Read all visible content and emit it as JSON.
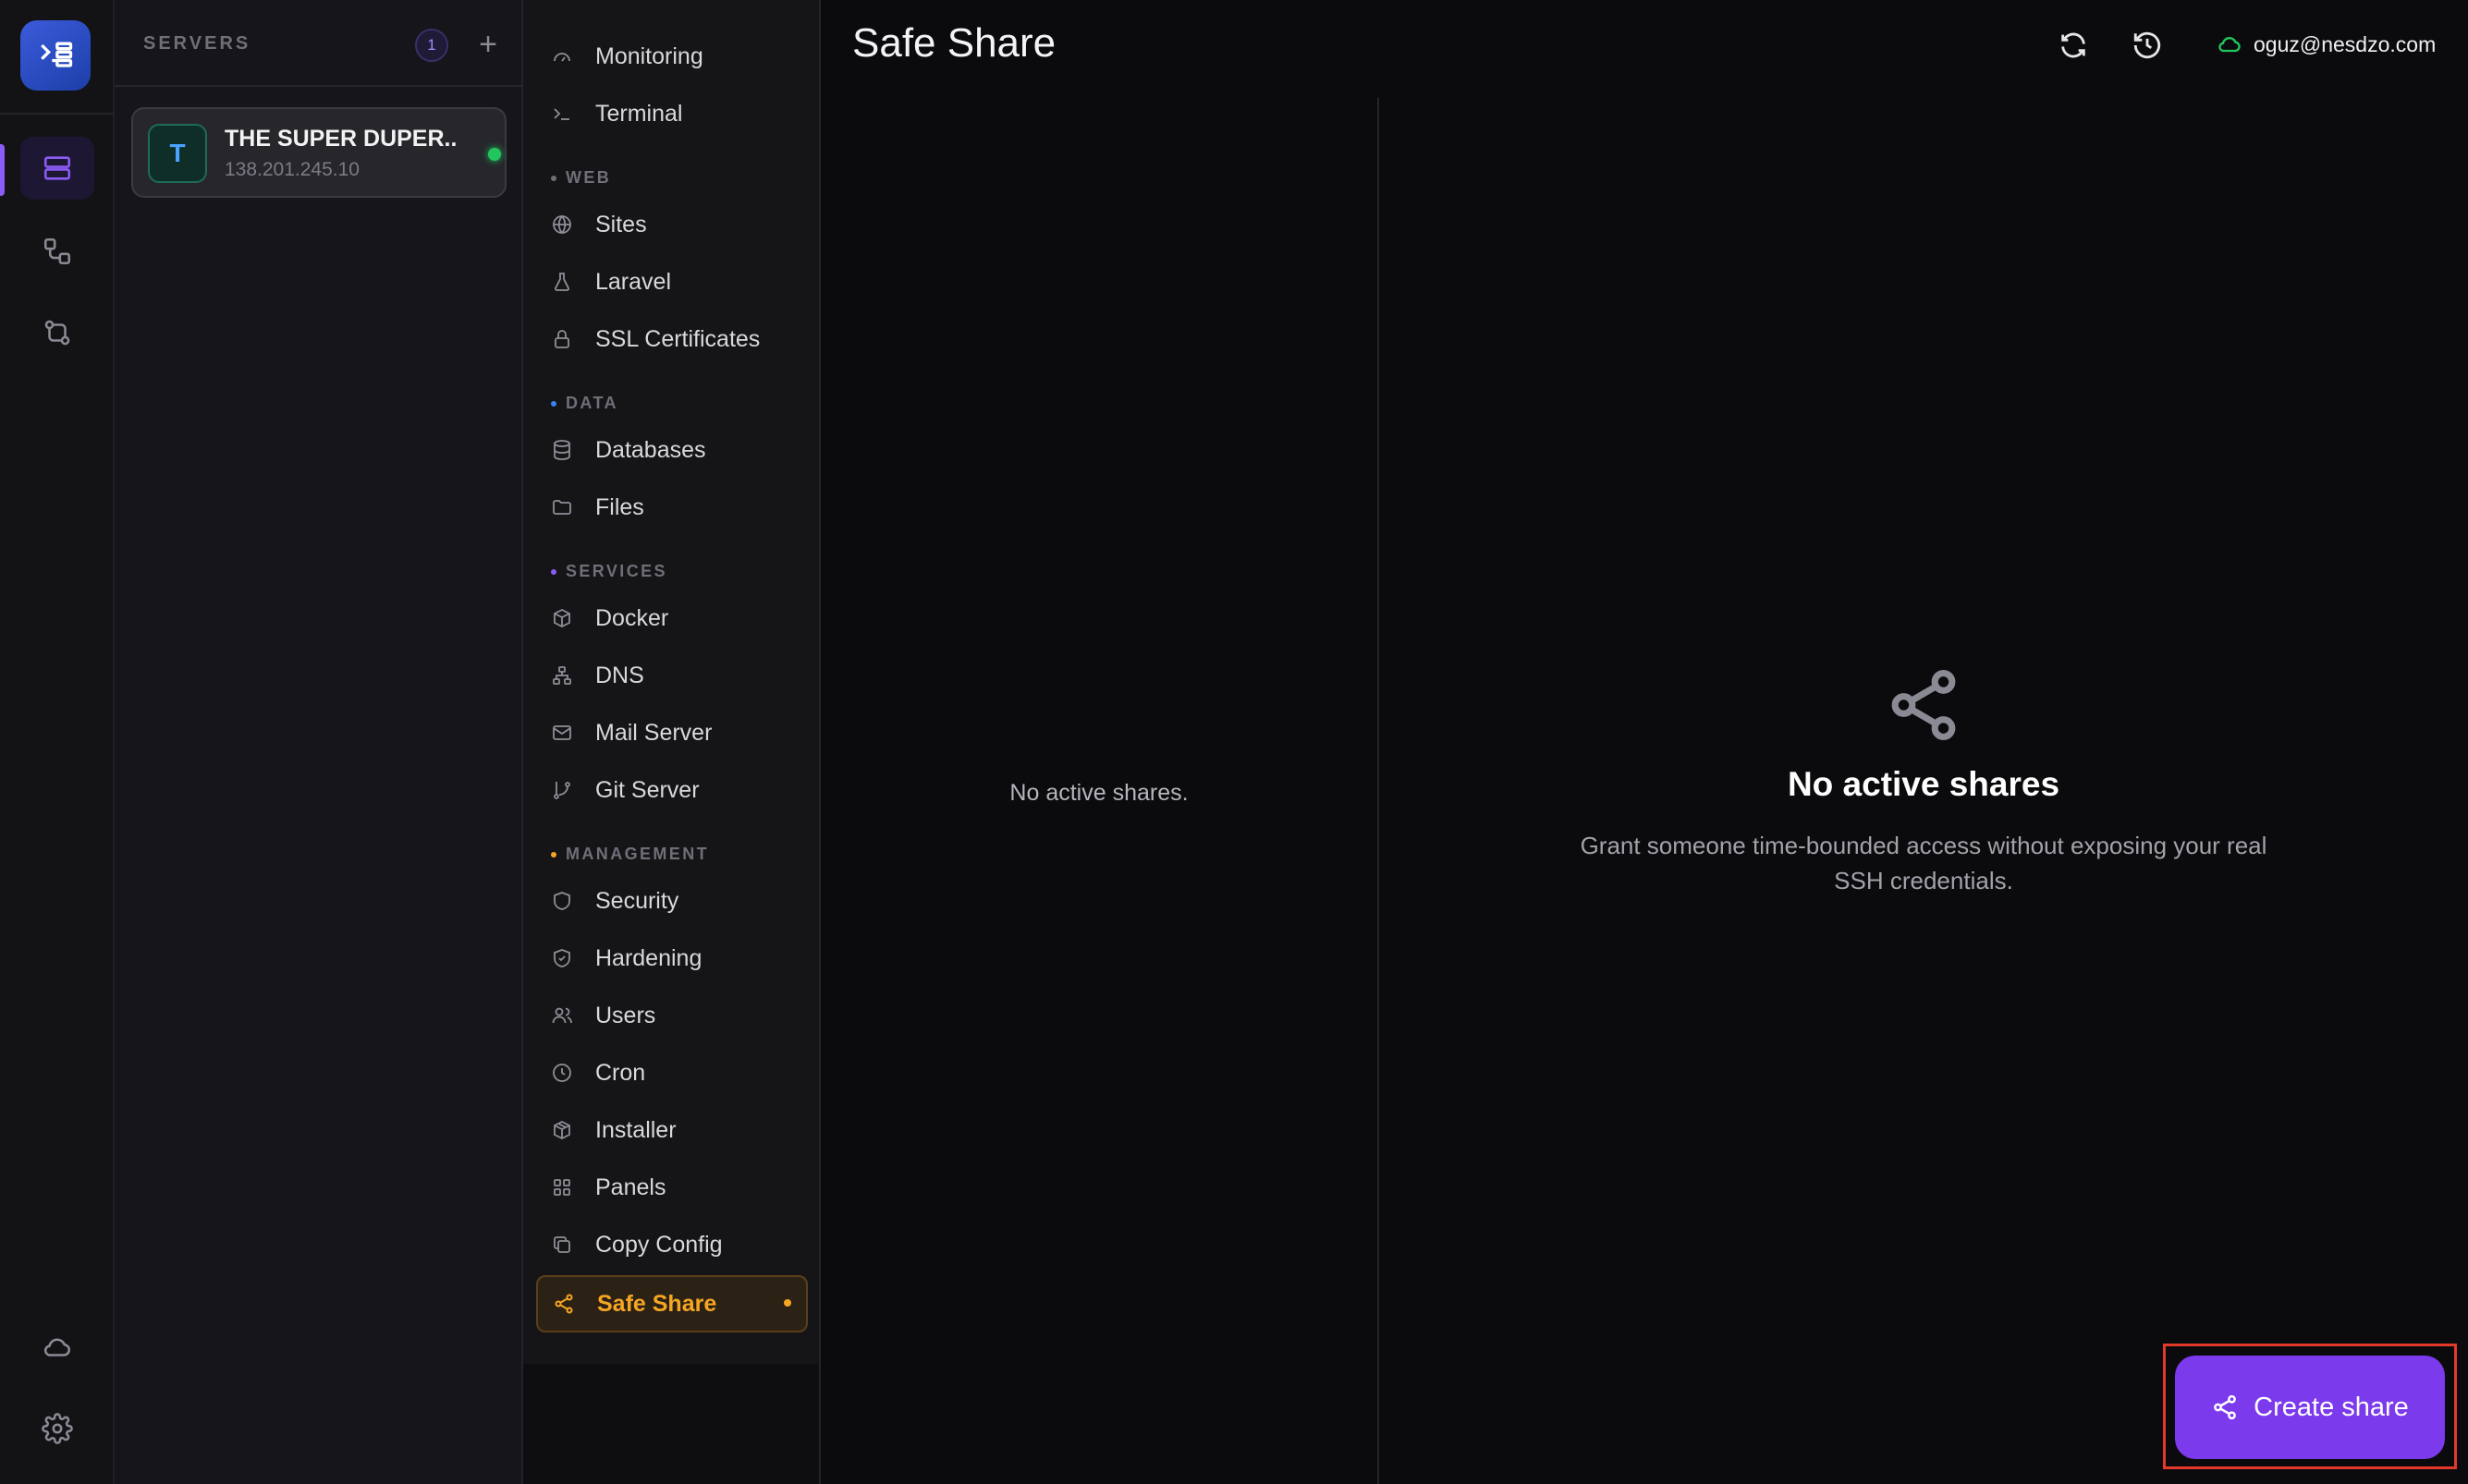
{
  "servers": {
    "heading": "SERVERS",
    "count": "1",
    "add": "+",
    "items": [
      {
        "initial": "T",
        "name": "THE SUPER DUPER...",
        "ip": "138.201.245.10",
        "status": "online"
      }
    ]
  },
  "rail": {
    "items": [
      "servers-icon",
      "workflow-icon",
      "sync-icon"
    ],
    "bottom": [
      "cloud-icon",
      "gear-icon"
    ]
  },
  "nav": {
    "monitoring": "Monitoring",
    "terminal": "Terminal",
    "section_web": "WEB",
    "sites": "Sites",
    "laravel": "Laravel",
    "ssl": "SSL Certificates",
    "section_data": "DATA",
    "databases": "Databases",
    "files": "Files",
    "section_services": "SERVICES",
    "docker": "Docker",
    "dns": "DNS",
    "mail": "Mail Server",
    "git": "Git Server",
    "section_management": "MANAGEMENT",
    "security": "Security",
    "hardening": "Hardening",
    "users": "Users",
    "cron": "Cron",
    "installer": "Installer",
    "panels": "Panels",
    "copy_config": "Copy Config",
    "safe_share": "Safe Share"
  },
  "header": {
    "title": "Safe Share",
    "account": "oguz@nesdzo.com"
  },
  "list": {
    "empty_text": "No active shares."
  },
  "empty_state": {
    "title": "No active shares",
    "description": "Grant someone time-bounded access without exposing your real SSH credentials."
  },
  "create_button": {
    "label": "Create share"
  },
  "colors": {
    "accent": "#7c3aed",
    "active_nav": "#f5a623",
    "online": "#22c55e",
    "highlight": "#e3392b"
  }
}
